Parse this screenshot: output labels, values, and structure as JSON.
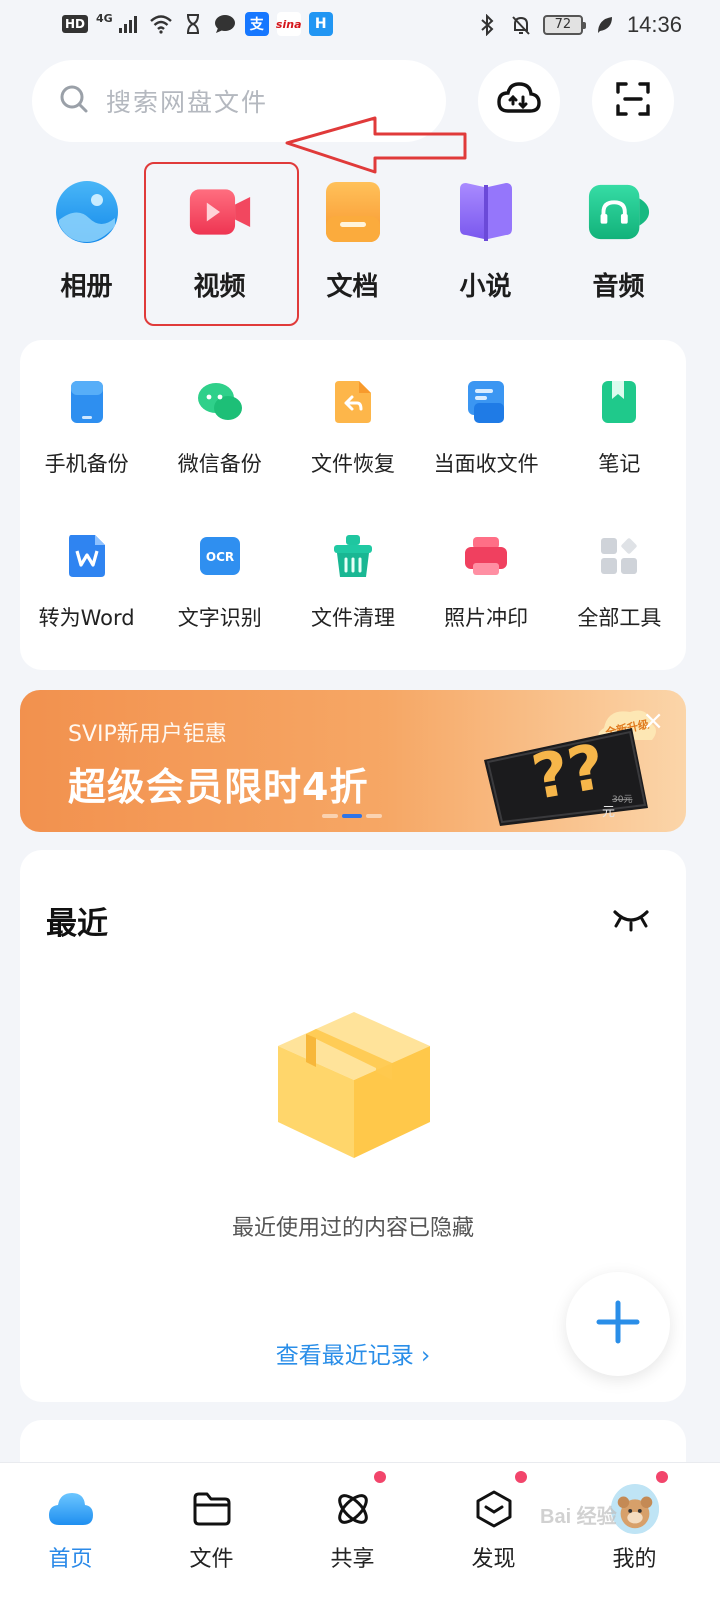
{
  "status_bar": {
    "network_badge": "HD",
    "network_type": "4G",
    "battery": "72",
    "time": "14:36"
  },
  "search": {
    "placeholder": "搜索网盘文件"
  },
  "categories": [
    {
      "label": "相册",
      "icon": "photo-album-icon",
      "color": "#2c9cf0"
    },
    {
      "label": "视频",
      "icon": "video-icon",
      "color": "#f0445b"
    },
    {
      "label": "文档",
      "icon": "document-icon",
      "color": "#f9a63a"
    },
    {
      "label": "小说",
      "icon": "novel-icon",
      "color": "#8a6cf0"
    },
    {
      "label": "音频",
      "icon": "audio-icon",
      "color": "#1cc48c"
    }
  ],
  "tools": [
    {
      "label": "手机备份",
      "icon": "phone-backup-icon"
    },
    {
      "label": "微信备份",
      "icon": "wechat-backup-icon"
    },
    {
      "label": "文件恢复",
      "icon": "file-restore-icon"
    },
    {
      "label": "当面收文件",
      "icon": "receive-file-icon"
    },
    {
      "label": "笔记",
      "icon": "notes-icon"
    },
    {
      "label": "转为Word",
      "icon": "convert-word-icon"
    },
    {
      "label": "文字识别",
      "icon": "ocr-icon"
    },
    {
      "label": "文件清理",
      "icon": "file-clean-icon"
    },
    {
      "label": "照片冲印",
      "icon": "photo-print-icon"
    },
    {
      "label": "全部工具",
      "icon": "all-tools-icon"
    }
  ],
  "promo": {
    "subtitle": "SVIP新用户钜惠",
    "title": "超级会员限时4折",
    "badge": "全新升级",
    "price_label": "元",
    "price_old": "30元",
    "close": "×"
  },
  "recent": {
    "title": "最近",
    "empty_text": "最近使用过的内容已隐藏",
    "link": "查看最近记录 ›"
  },
  "bottom_nav": [
    {
      "label": "首页",
      "icon": "home-cloud-icon",
      "active": true,
      "badge": false
    },
    {
      "label": "文件",
      "icon": "folder-icon",
      "active": false,
      "badge": false
    },
    {
      "label": "共享",
      "icon": "share-atom-icon",
      "active": false,
      "badge": true
    },
    {
      "label": "发现",
      "icon": "discover-box-icon",
      "active": false,
      "badge": true
    },
    {
      "label": "我的",
      "icon": "avatar-icon",
      "active": false,
      "badge": true
    }
  ],
  "watermark": "Bai 经验"
}
